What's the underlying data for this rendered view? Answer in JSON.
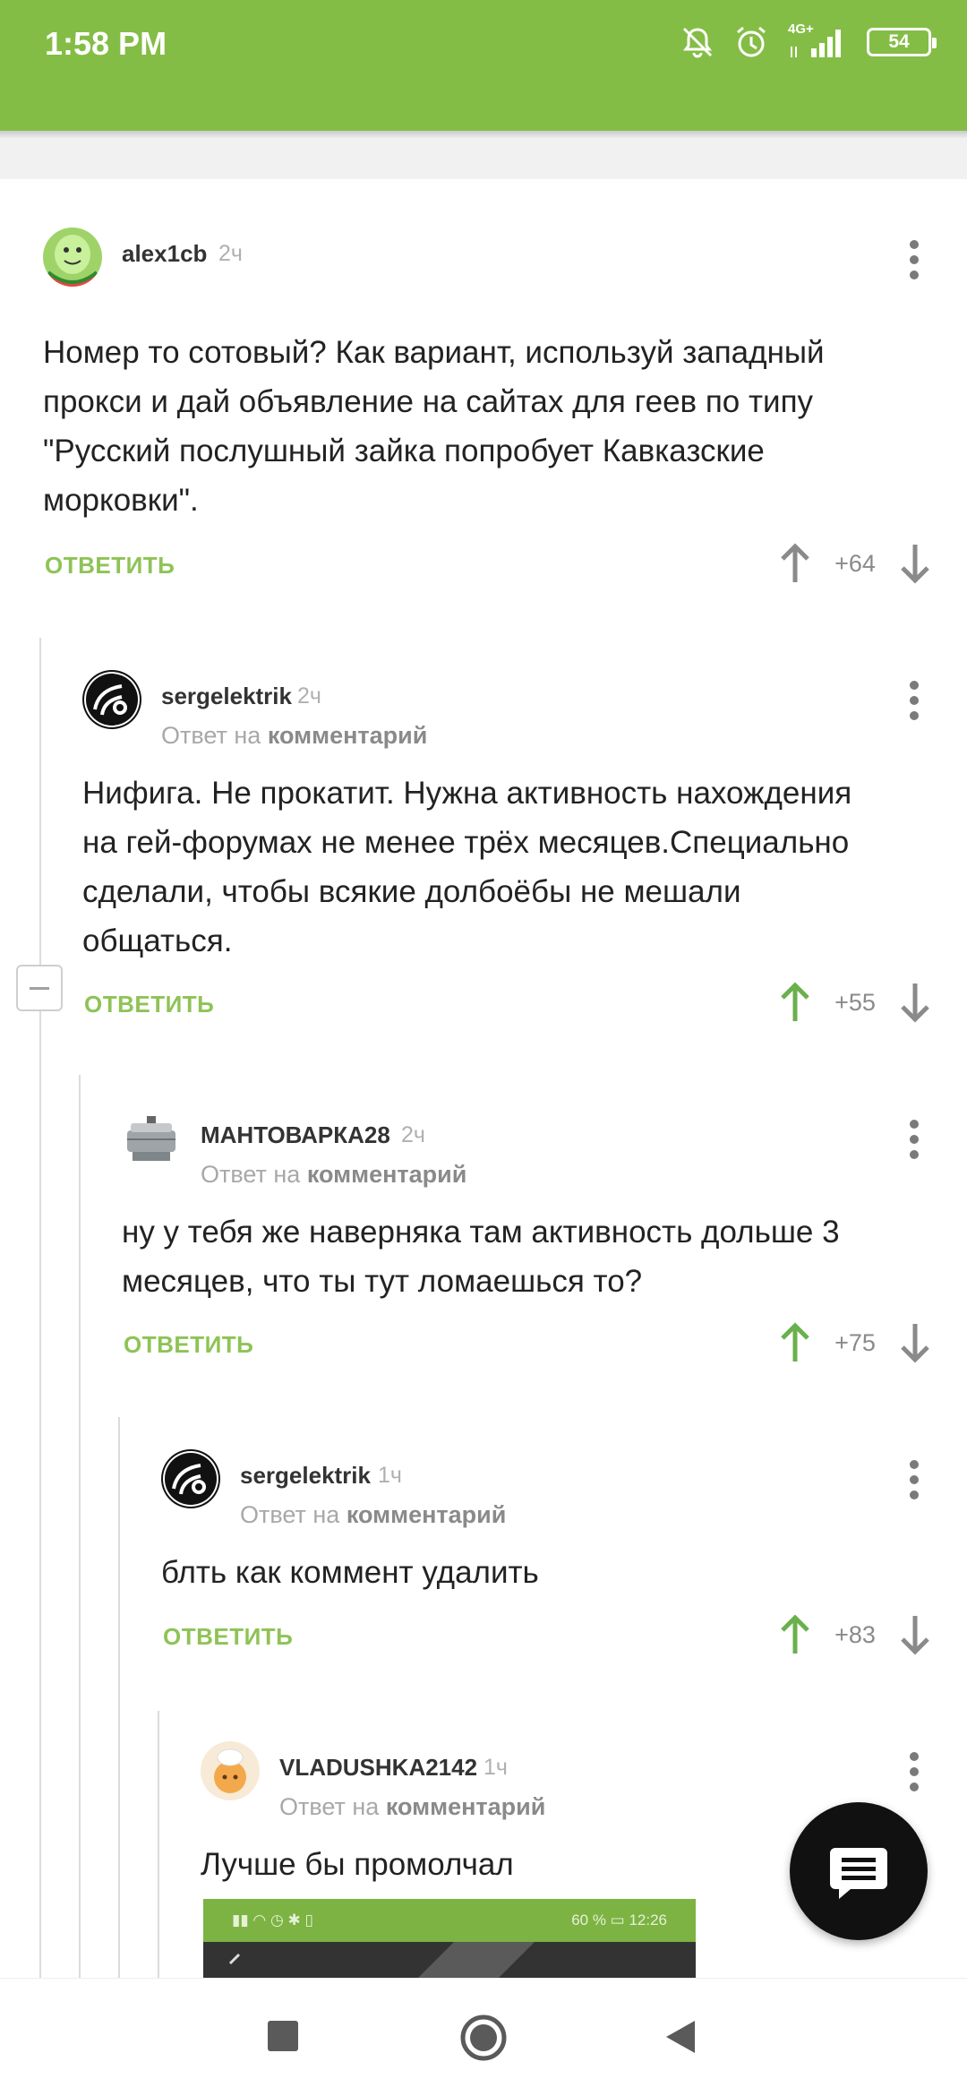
{
  "status_bar": {
    "time": "1:58 PM",
    "network": "4G+",
    "battery": "54",
    "icons": [
      "notifications-off-icon",
      "alarm-icon",
      "signal-icon",
      "battery-icon"
    ]
  },
  "colors": {
    "accent": "#84bd45",
    "reply": "#8ec356",
    "upvoted": "#6ab04c"
  },
  "comments": [
    {
      "username": "alex1cb",
      "time": "2ч",
      "lines": [
        "Номер то сотовый? Как вариант, используй западный",
        "прокси и дай объявление на сайтах для геев по типу",
        "\"Русский послушный зайка попробует Кавказские",
        "морковки\"."
      ],
      "reply_label": "ОТВЕТИТЬ",
      "score": "+64",
      "upvoted": false
    },
    {
      "username": "sergelektrik",
      "time": "2ч",
      "reply_prefix": "Ответ на",
      "reply_target": "комментарий",
      "lines": [
        "Нифига. Не прокатит. Нужна активность нахождения",
        "на гей-форумах не менее трёх месяцев.Специально",
        "сделали, чтобы всякие долбоёбы не мешали",
        "общаться."
      ],
      "reply_label": "ОТВЕТИТЬ",
      "score": "+55",
      "upvoted": true
    },
    {
      "username": "МАНТОВАРКА28",
      "time": "2ч",
      "reply_prefix": "Ответ на",
      "reply_target": "комментарий",
      "lines": [
        "ну у тебя же наверняка там активность дольше 3",
        "месяцев, что ты тут ломаешься то?"
      ],
      "reply_label": "ОТВЕТИТЬ",
      "score": "+75",
      "upvoted": true
    },
    {
      "username": "sergelektrik",
      "time": "1ч",
      "reply_prefix": "Ответ на",
      "reply_target": "комментарий",
      "lines": [
        "блть как коммент удалить"
      ],
      "reply_label": "ОТВЕТИТЬ",
      "score": "+83",
      "upvoted": true
    },
    {
      "username": "VLADUSHKA2142",
      "time": "1ч",
      "reply_prefix": "Ответ на",
      "reply_target": "комментарий",
      "lines": [
        "Лучше бы промолчал"
      ]
    }
  ],
  "embedded_screenshot": {
    "battery": "60 %",
    "time": "12:26"
  },
  "fab_icon": "comment-icon",
  "navigation": [
    "recents-square-icon",
    "home-circle-icon",
    "back-triangle-icon"
  ]
}
